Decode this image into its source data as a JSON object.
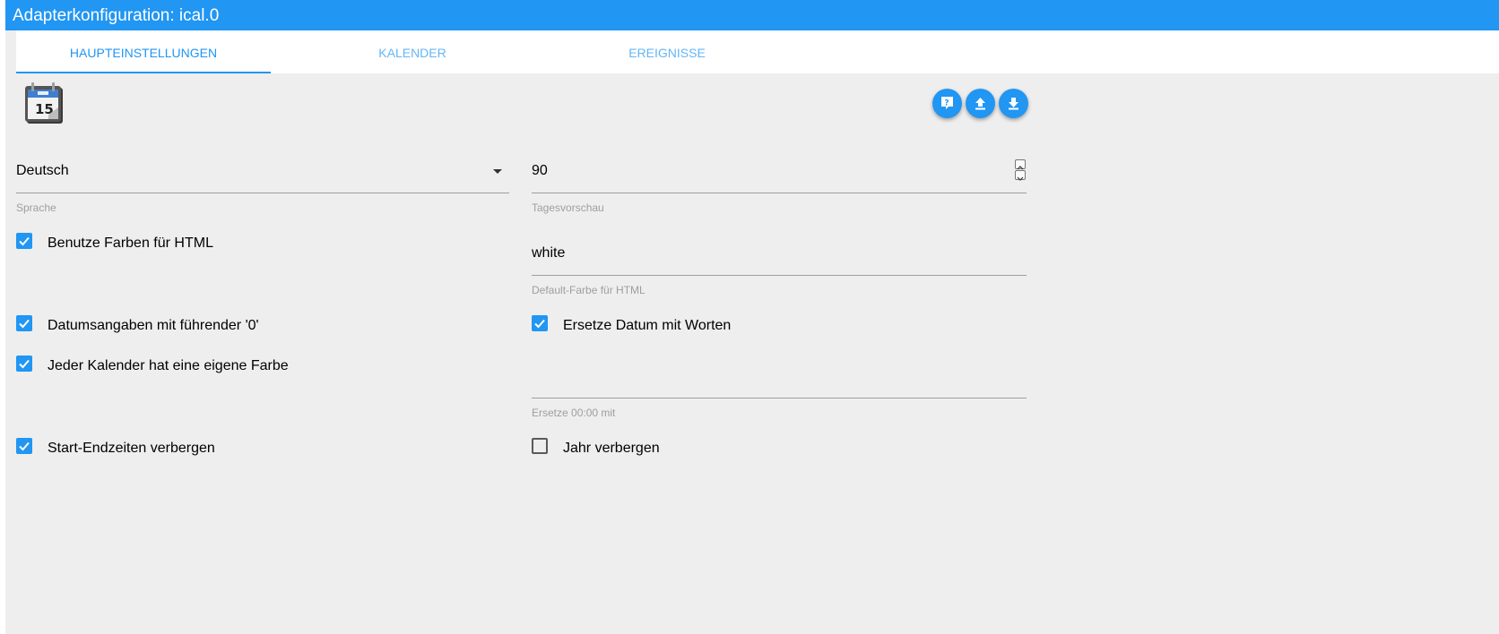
{
  "window": {
    "title": "Adapterkonfiguration: ical.0"
  },
  "tabs": [
    {
      "label": "HAUPTEINSTELLUNGEN",
      "active": true
    },
    {
      "label": "KALENDER",
      "active": false
    },
    {
      "label": "EREIGNISSE",
      "active": false
    }
  ],
  "logo": {
    "icon": "calendar-icon",
    "day": "15"
  },
  "toolbar": {
    "help_icon": "help-icon",
    "upload_icon": "upload-icon",
    "download_icon": "download-icon",
    "accent_color": "#2196f3"
  },
  "settings": {
    "language": {
      "value": "Deutsch",
      "label": "Sprache"
    },
    "days_preview": {
      "value": "90",
      "label": "Tagesvorschau"
    },
    "use_colors": {
      "label": "Benutze Farben für HTML",
      "checked": true
    },
    "default_color": {
      "value": "white",
      "label": "Default-Farbe für HTML"
    },
    "leading_zero": {
      "label": "Datumsangaben mit führender '0'",
      "checked": true
    },
    "replace_date_words": {
      "label": "Ersetze Datum mit Worten",
      "checked": true
    },
    "calendar_own_color": {
      "label": "Jeder Kalender hat eine eigene Farbe",
      "checked": true
    },
    "replace_midnight": {
      "value": "",
      "label": "Ersetze 00:00 mit"
    },
    "hide_start_end": {
      "label": "Start-Endzeiten verbergen",
      "checked": true
    },
    "hide_year": {
      "label": "Jahr verbergen",
      "checked": false
    }
  }
}
